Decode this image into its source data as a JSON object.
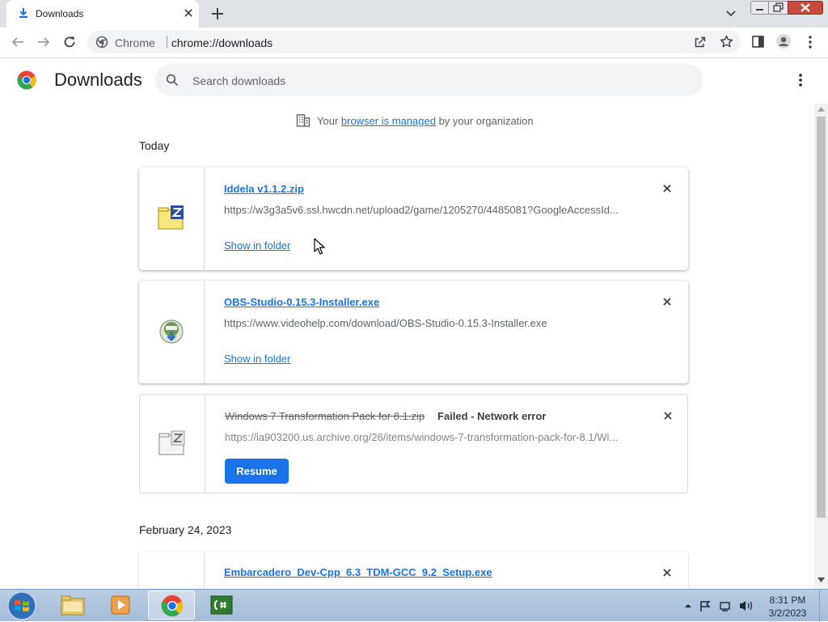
{
  "browser": {
    "tab_title": "Downloads",
    "site_name": "Chrome",
    "url": "chrome://downloads"
  },
  "page": {
    "title": "Downloads",
    "search_placeholder": "Search downloads",
    "managed": {
      "prefix": "Your ",
      "link": "browser is managed",
      "suffix": " by your organization"
    }
  },
  "groups": [
    {
      "date": "Today",
      "items": [
        {
          "file_name": "Iddela v1.1.2.zip",
          "url": "https://w3g3a5v6.ssl.hwcdn.net/upload2/game/1205270/4485081?GoogleAccessId...",
          "action": "Show in folder",
          "icon": "zip-file-icon"
        },
        {
          "file_name": "OBS-Studio-0.15.3-Installer.exe",
          "url": "https://www.videohelp.com/download/OBS-Studio-0.15.3-Installer.exe",
          "action": "Show in folder",
          "icon": "installer-icon"
        },
        {
          "file_name": "Windows 7 Transformation Pack for 8.1.zip",
          "status": "Failed - Network error",
          "url": "https://ia903200.us.archive.org/26/items/windows-7-transformation-pack-for-8.1/Wi...",
          "action": "Resume",
          "icon": "zip-file-icon"
        }
      ]
    },
    {
      "date": "February 24, 2023",
      "items": [
        {
          "file_name": "Embarcadero_Dev-Cpp_6.3_TDM-GCC_9.2_Setup.exe",
          "icon": "installer-icon"
        }
      ]
    }
  ],
  "taskbar": {
    "apps": [
      "windows-explorer",
      "media-player",
      "google-chrome",
      "csharp-ide"
    ],
    "active_app": "google-chrome",
    "time": "8:31 PM",
    "date": "3/2/2023"
  },
  "colors": {
    "accent": "#1a73e8",
    "tabstrip": "#dee1e6",
    "omnibox": "#f1f3f4"
  }
}
